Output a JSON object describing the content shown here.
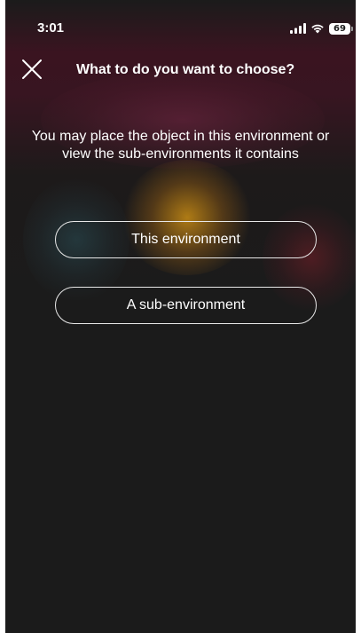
{
  "status_bar": {
    "time": "3:01",
    "battery_level": "69",
    "icons": [
      "cellular-signal-icon",
      "wifi-icon",
      "battery-icon"
    ]
  },
  "header": {
    "close_icon": "close-icon",
    "title": "What to do you want to choose?"
  },
  "prompt": {
    "line1": "You may place the object in this environment or",
    "line2": "view the sub-environments it contains"
  },
  "options": [
    {
      "label": "This environment"
    },
    {
      "label": "A sub-environment"
    }
  ],
  "colors": {
    "background": "#1b1b1b",
    "text": "#ffffff",
    "button_border": "#e8e8e8",
    "blur_accent_pink": "#3a1420",
    "blur_accent_yellow": "#c88c14"
  }
}
